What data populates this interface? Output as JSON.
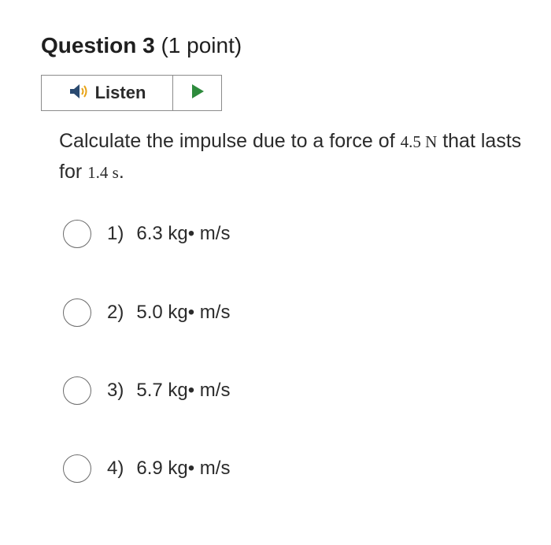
{
  "question": {
    "title": "Question 3",
    "points": " (1 point)"
  },
  "listen": {
    "label": "Listen",
    "speaker_icon": "speaker-icon",
    "play_icon": "play-icon",
    "play_color": "#2e8b3d"
  },
  "prompt": {
    "text_1": "Calculate the impulse due to a force of ",
    "force_value": "4.5 N",
    "text_2": " that lasts for ",
    "time_value": "1.4 s",
    "text_3": "."
  },
  "options": [
    {
      "number": "1)",
      "text": "6.3 kg• m/s"
    },
    {
      "number": "2)",
      "text": "5.0 kg• m/s"
    },
    {
      "number": "3)",
      "text": "5.7 kg• m/s"
    },
    {
      "number": "4)",
      "text": "6.9 kg• m/s"
    }
  ]
}
